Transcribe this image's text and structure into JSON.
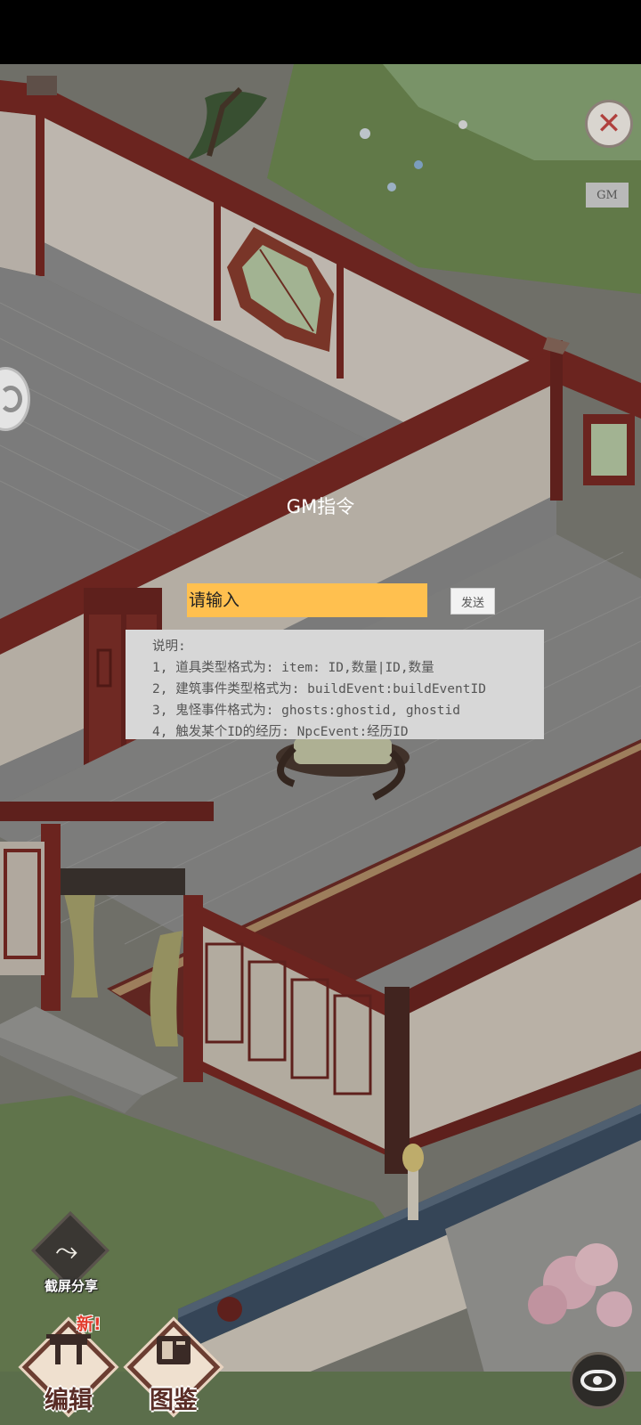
{
  "gm_panel": {
    "title": "GM指令",
    "input_placeholder": "请输入",
    "send_label": "发送",
    "instructions": [
      "说明:",
      "1, 道具类型格式为: item: ID,数量|ID,数量",
      "2, 建筑事件类型格式为: buildEvent:buildEventID",
      "3, 鬼怪事件格式为:  ghosts:ghostid, ghostid",
      "4, 触发某个ID的经历: NpcEvent:经历ID"
    ]
  },
  "top_right": {
    "close_symbol": "✕",
    "gm_label": "GM"
  },
  "bottom_bar": {
    "share_label": "截屏分享",
    "edit_label": "编辑",
    "edit_badge": "新!",
    "catalog_label": "图鉴"
  },
  "icons": [
    "close-icon",
    "swirl-icon",
    "share-icon",
    "edit-icon",
    "catalog-icon",
    "eye-icon"
  ],
  "colors": {
    "input_bg": "#ffc04f",
    "instructions_bg": "#d7d7d7",
    "wall_red": "#7a2a24",
    "roof_tiles": "#3d4f63"
  }
}
